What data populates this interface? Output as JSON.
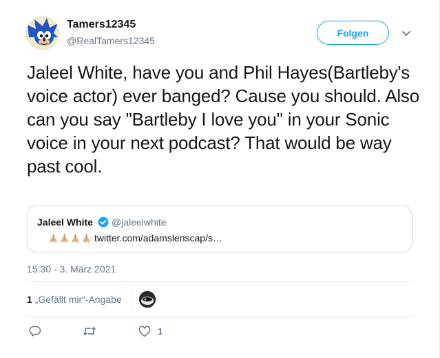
{
  "user": {
    "display_name": "Tamers12345",
    "handle": "@RealTamers12345",
    "avatar_icon": "sonic-avatar-icon"
  },
  "follow_button": {
    "label": "Folgen"
  },
  "tweet": {
    "text": "Jaleel White, have you and Phil Hayes(Bartleby's voice actor) ever banged? Cause you should. Also can you say \"Bartleby I love you\" in your Sonic voice in your next podcast? That would be way past cool."
  },
  "quoted_tweet": {
    "display_name": "Jaleel White",
    "handle": "@jaleelwhite",
    "emoji": [
      "🙏🏼",
      "🙏🏼",
      "🙏🏼",
      "🙏🏼"
    ],
    "link_text": "twitter.com/adamslenscap/s…"
  },
  "timestamp": "15:30 - 3. März 2021",
  "stats": {
    "likes_count": "1",
    "likes_label": "„Gefällt mir“-Angabe"
  },
  "actions": {
    "like_count": "1"
  },
  "colors": {
    "accent": "#1da1f2",
    "text": "#14171a",
    "secondary": "#657786",
    "border": "#e6ecf0"
  }
}
